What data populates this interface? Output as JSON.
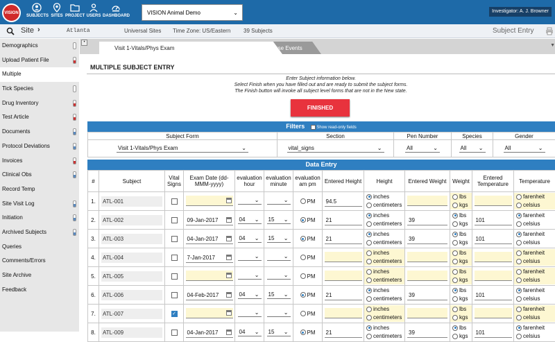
{
  "topnav": {
    "logo": "VISION",
    "items": [
      {
        "label": "SUBJECTS",
        "icon": "user-circle-icon"
      },
      {
        "label": "SITES",
        "icon": "location-pin-icon"
      },
      {
        "label": "PROJECT",
        "icon": "folder-icon"
      },
      {
        "label": "USERS",
        "icon": "users-icon"
      },
      {
        "label": "DASHBOARD",
        "icon": "dashboard-gauge-icon"
      }
    ],
    "study": "VISION Animal Demo",
    "investigator": "Investigator: A. J. Browner"
  },
  "sitebar": {
    "site_label": "Site",
    "site_value": "Atlanta",
    "sites": "Universal Sites",
    "timezone": "Time Zone: US/Eastern",
    "subjects": "39 Subjects",
    "mode": "Subject Entry"
  },
  "sidebar": {
    "items": [
      {
        "label": "Demographics",
        "icon": "grey"
      },
      {
        "label": "Upload Patient File",
        "icon": "red"
      },
      {
        "label": "Multiple",
        "icon": "",
        "active": true
      },
      {
        "label": "Tick Species",
        "icon": "grey"
      },
      {
        "label": "Drug Inventory",
        "icon": "red"
      },
      {
        "label": "Test Article",
        "icon": "red"
      },
      {
        "label": "Documents",
        "icon": "blue"
      },
      {
        "label": "Protocol Deviations",
        "icon": "blue"
      },
      {
        "label": "Invoices",
        "icon": "red"
      },
      {
        "label": "Clinical Obs",
        "icon": "blue"
      },
      {
        "label": "Record Temp",
        "icon": ""
      },
      {
        "label": "Site Visit Log",
        "icon": "blue"
      },
      {
        "label": "Initiation",
        "icon": "blue"
      },
      {
        "label": "Archived Subjects",
        "icon": "blue"
      },
      {
        "label": "Queries",
        "icon": ""
      },
      {
        "label": "Comments/Errors",
        "icon": ""
      },
      {
        "label": "Site Archive",
        "icon": ""
      },
      {
        "label": "Feedback",
        "icon": ""
      }
    ]
  },
  "tabs": {
    "tab1": "Visit 1-Vitals/Phys Exam",
    "tab2": "Adverse Events-Adverse Events"
  },
  "page": {
    "heading": "MULTIPLE SUBJECT ENTRY",
    "instr1": "Enter Subject information below.",
    "instr2": "Select Finish when you have filled out and are ready to submit the subject forms.",
    "instr3": "The Finish button will invoke all subject level forms that are not in the New state.",
    "finish": "FINISHED"
  },
  "filters": {
    "title": "Filters",
    "readonly_label": "Show read-only fields",
    "headers": [
      "Subject Form",
      "Section",
      "Pen Number",
      "Species",
      "Gender"
    ],
    "values": [
      "Visit 1-Vitals/Phys Exam",
      "vital_signs",
      "All",
      "All",
      "All"
    ]
  },
  "data_entry": {
    "title": "Data Entry",
    "headers": [
      "#",
      "Subject",
      "Vital Signs",
      "Exam Date (dd-MMM-yyyy)",
      "evaluation hour",
      "evaluation minute",
      "evaluation am pm",
      "Entered Height",
      "Height",
      "Entered Weight",
      "Weight",
      "Entered Temperature",
      "Temperature"
    ],
    "pm_label": "PM",
    "height_units": [
      "inches",
      "centimeters"
    ],
    "weight_units": [
      "lbs",
      "kgs"
    ],
    "temp_units": [
      "farenheit",
      "celsius"
    ],
    "rows": [
      {
        "n": "1.",
        "subject": "ATL-001",
        "vs": false,
        "date": "",
        "hour": "",
        "minute": "",
        "pm": false,
        "height": "94.5",
        "hunit": 0,
        "weight": "",
        "wunit": -1,
        "temp": "",
        "tunit": -1,
        "filled": false
      },
      {
        "n": "2.",
        "subject": "ATL-002",
        "vs": false,
        "date": "09-Jan-2017",
        "hour": "04",
        "minute": "15",
        "pm": true,
        "height": "21",
        "hunit": 0,
        "weight": "39",
        "wunit": 0,
        "temp": "101",
        "tunit": 0,
        "filled": true
      },
      {
        "n": "3.",
        "subject": "ATL-003",
        "vs": false,
        "date": "04-Jan-2017",
        "hour": "04",
        "minute": "15",
        "pm": true,
        "height": "21",
        "hunit": 0,
        "weight": "39",
        "wunit": 0,
        "temp": "101",
        "tunit": 0,
        "filled": true
      },
      {
        "n": "4.",
        "subject": "ATL-004",
        "vs": false,
        "date": "7-Jan-2017",
        "hour": "",
        "minute": "",
        "pm": false,
        "height": "",
        "hunit": -1,
        "weight": "",
        "wunit": -1,
        "temp": "",
        "tunit": -1,
        "filled": false
      },
      {
        "n": "5.",
        "subject": "ATL-005",
        "vs": false,
        "date": "",
        "hour": "",
        "minute": "",
        "pm": false,
        "height": "",
        "hunit": -1,
        "weight": "",
        "wunit": -1,
        "temp": "",
        "tunit": -1,
        "filled": false
      },
      {
        "n": "6.",
        "subject": "ATL-006",
        "vs": false,
        "date": "04-Feb-2017",
        "hour": "04",
        "minute": "15",
        "pm": true,
        "height": "21",
        "hunit": 0,
        "weight": "39",
        "wunit": 0,
        "temp": "101",
        "tunit": 0,
        "filled": true
      },
      {
        "n": "7.",
        "subject": "ATL-007",
        "vs": true,
        "date": "",
        "hour": "",
        "minute": "",
        "pm": false,
        "height": "",
        "hunit": -1,
        "weight": "",
        "wunit": -1,
        "temp": "",
        "tunit": -1,
        "filled": false
      },
      {
        "n": "8.",
        "subject": "ATL-009",
        "vs": false,
        "date": "04-Jan-2017",
        "hour": "04",
        "minute": "15",
        "pm": true,
        "height": "21",
        "hunit": 0,
        "weight": "39",
        "wunit": 0,
        "temp": "101",
        "tunit": 0,
        "filled": true
      }
    ]
  }
}
